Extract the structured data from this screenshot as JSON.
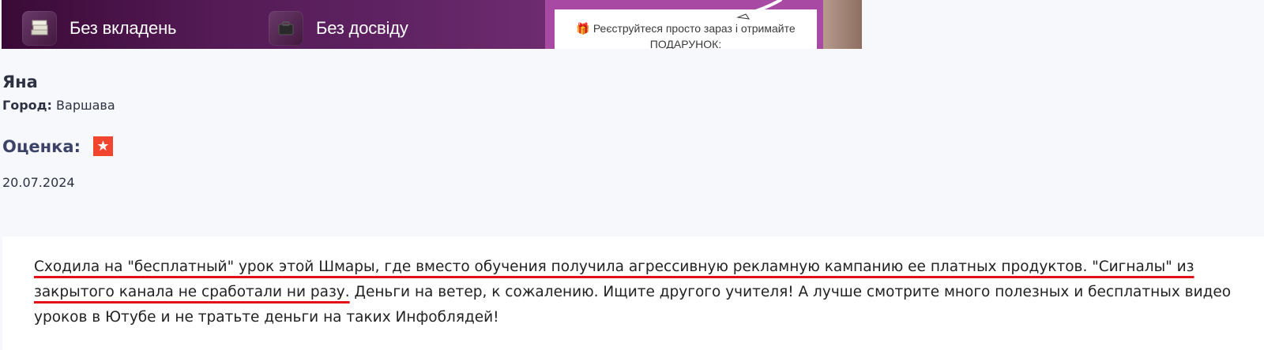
{
  "banner": {
    "features": [
      {
        "label": "Без вкладень",
        "icon": "money-stack-icon"
      },
      {
        "label": "Без досвіду",
        "icon": "briefcase-icon"
      }
    ],
    "promo_text": "Реєструйтеся просто зараз і отримайте",
    "promo_text2": "ПОДАРУНОК:"
  },
  "review": {
    "author": "Яна",
    "city_label": "Город:",
    "city_value": "Варшава",
    "rating_label": "Оценка:",
    "rating_stars": 1,
    "date": "20.07.2024",
    "text_underlined": "Сходила на \"бесплатный\" урок этой Шмары, где вместо обучения получила агрессивную рекламную кампанию ее платных продуктов. \"Сигналы\" из закрытого канала не сработали ни разу.",
    "text_rest": " Деньги на ветер, к сожалению. Ищите другого учителя! А лучше смотрите много полезных и бесплатных видео уроков в Ютубе и не тратьте деньги на таких Инфоблядей!"
  },
  "colors": {
    "banner_purple": "#541b56",
    "star_red": "#f1452f",
    "underline_red": "#e3101a",
    "page_bg": "#f6f8fb"
  }
}
